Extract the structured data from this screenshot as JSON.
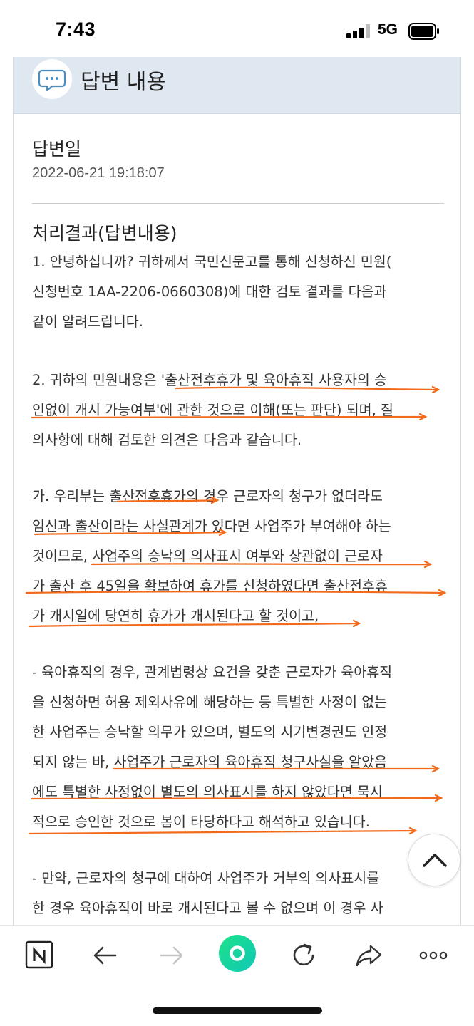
{
  "status_bar": {
    "time": "7:43",
    "network": "5G"
  },
  "header": {
    "title": "답변 내용",
    "icon": "speech-bubble-icon"
  },
  "answer_date": {
    "label": "답변일",
    "value": "2022-06-21 19:18:07"
  },
  "result": {
    "label": "처리결과(답변내용)",
    "lines": [
      "1. 안녕하십니까? 귀하께서 국민신문고를 통해 신청하신 민원(",
      "신청번호 1AA-2206-0660308)에 대한 검토 결과를 다음과",
      "같이 알려드립니다.",
      "2. 귀하의 민원내용은 '출산전후휴가 및 육아휴직 사용자의 승",
      "인없이 개시 가능여부'에 관한 것으로 이해(또는 판단) 되며, 질",
      "의사항에 대해 검토한 의견은 다음과 같습니다.",
      "가. 우리부는 출산전후휴가의 경우 근로자의 청구가 없더라도",
      "임신과 출산이라는 사실관계가 있다면 사업주가 부여해야 하는",
      "것이므로, 사업주의 승낙의 의사표시 여부와 상관없이 근로자",
      "가 출산 후 45일을 확보하여 휴가를 신청하였다면 출산전후휴",
      "가 개시일에 당연히 휴가가 개시된다고 할 것이고,",
      "- 육아휴직의 경우, 관계법령상 요건을 갖춘 근로자가 육아휴직",
      "을 신청하면 허용 제외사유에 해당하는 등 특별한 사정이 없는",
      "한 사업주는 승낙할 의무가 있으며, 별도의 시기변경권도 인정",
      "되지 않는 바, 사업주가 근로자의 육아휴직 청구사실을 알았음",
      "에도 특별한 사정없이 별도의 의사표시를 하지 않았다면 묵시",
      "적으로 승인한 것으로 봄이 타당하다고 해석하고 있습니다.",
      "- 만약, 근로자의 청구에 대하여 사업주가 거부의 의사표시를",
      "한 경우 육아휴직이 바로 개시된다고 볼 수 없으며 이 경우 사"
    ]
  },
  "colors": {
    "header_bg": "#dfe8f1",
    "underline": "#f26b1d",
    "icon_color": "#4a8fc0"
  },
  "toolbar": {
    "items": [
      "naver-n-icon",
      "back-arrow-icon",
      "forward-arrow-icon",
      "green-home-icon",
      "reload-icon",
      "share-icon",
      "more-icon"
    ]
  }
}
